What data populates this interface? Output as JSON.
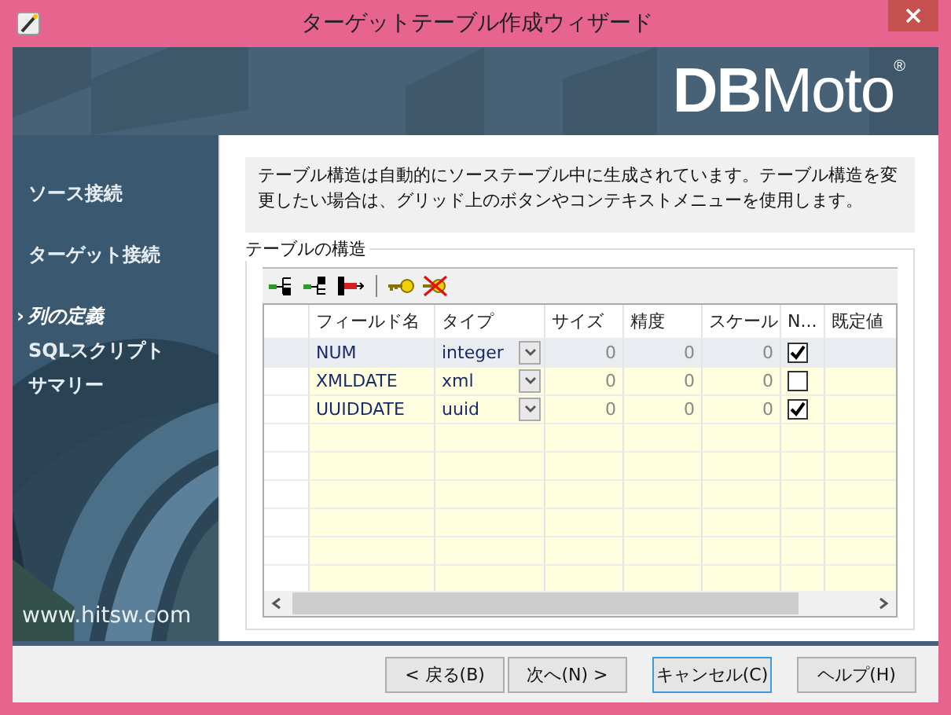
{
  "window": {
    "title": "ターゲットテーブル作成ウィザード"
  },
  "banner": {
    "logo": "**DB**Moto$^{®}$"
  },
  "sidebar": {
    "items": [
      {
        "label": "ソース接続",
        "selected": false
      },
      {
        "label": "ターゲット接続",
        "selected": false
      },
      {
        "label": "列の定義",
        "selected": true
      },
      {
        "label": "SQLスクリプト",
        "selected": false
      },
      {
        "label": "サマリー",
        "selected": false
      }
    ],
    "marker": "›",
    "website": "www.hitsw.com"
  },
  "description": "テーブル構造は自動的にソーステーブル中に生成されています。テーブル構造を変更したい場合は、グリッド上のボタンやコンテキストメニューを使用します。",
  "group": {
    "title": "テーブルの構造"
  },
  "table": {
    "columns": [
      "フィールド名",
      "タイプ",
      "サイズ",
      "精度",
      "スケール",
      "N...",
      "既定値"
    ],
    "rows": [
      {
        "name": "NUM",
        "type": "integer",
        "size": "0",
        "precision": "0",
        "scale": "0",
        "nullable": true,
        "selected": true
      },
      {
        "name": "XMLDATE",
        "type": "xml",
        "size": "0",
        "precision": "0",
        "scale": "0",
        "nullable": false,
        "selected": false
      },
      {
        "name": "UUIDDATE",
        "type": "uuid",
        "size": "0",
        "precision": "0",
        "scale": "0",
        "nullable": true,
        "selected": false
      }
    ]
  },
  "buttons": [
    {
      "label": "< 戻る(B)",
      "default": false
    },
    {
      "label": "次へ(N) >",
      "default": false
    },
    {
      "label": "キャンセル(C)",
      "default": true
    },
    {
      "label": "ヘルプ(H)",
      "default": false
    }
  ]
}
